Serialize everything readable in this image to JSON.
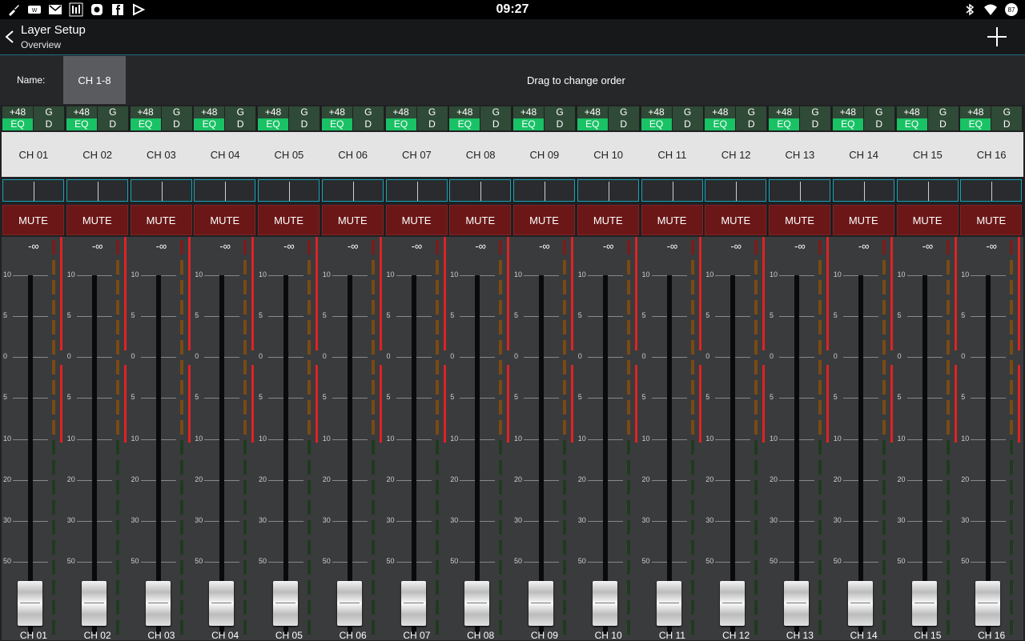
{
  "status_bar": {
    "time": "09:27",
    "left_icons": [
      "guitar-icon",
      "wifi-alt-icon",
      "gmail-icon",
      "mixer-icon",
      "camera-icon",
      "facebook-icon",
      "app-icon"
    ],
    "right_icons": [
      "bluetooth-icon",
      "wifi-icon",
      "battery-icon"
    ],
    "battery": "87"
  },
  "header": {
    "title": "Layer Setup",
    "subtitle": "Overview"
  },
  "name_row": {
    "label": "Name:",
    "value": "CH 1-8",
    "hint": "Drag to change order"
  },
  "strip_labels": {
    "phantom": "+48",
    "gate": "G",
    "eq": "EQ",
    "dyn": "D",
    "mute": "MUTE",
    "level": "-∞"
  },
  "scale_labels": [
    "10",
    "5",
    "0",
    "5",
    "10",
    "20",
    "30",
    "50"
  ],
  "colors": {
    "eq_active": "#19c265",
    "mute": "#6b1717",
    "accent": "#17a5b5"
  },
  "channels": [
    {
      "name": "CH 01"
    },
    {
      "name": "CH 02"
    },
    {
      "name": "CH 03"
    },
    {
      "name": "CH 04"
    },
    {
      "name": "CH 05"
    },
    {
      "name": "CH 06"
    },
    {
      "name": "CH 07"
    },
    {
      "name": "CH 08"
    },
    {
      "name": "CH 09"
    },
    {
      "name": "CH 10"
    },
    {
      "name": "CH 11"
    },
    {
      "name": "CH 12"
    },
    {
      "name": "CH 13"
    },
    {
      "name": "CH 14"
    },
    {
      "name": "CH 15"
    },
    {
      "name": "CH 16"
    }
  ]
}
